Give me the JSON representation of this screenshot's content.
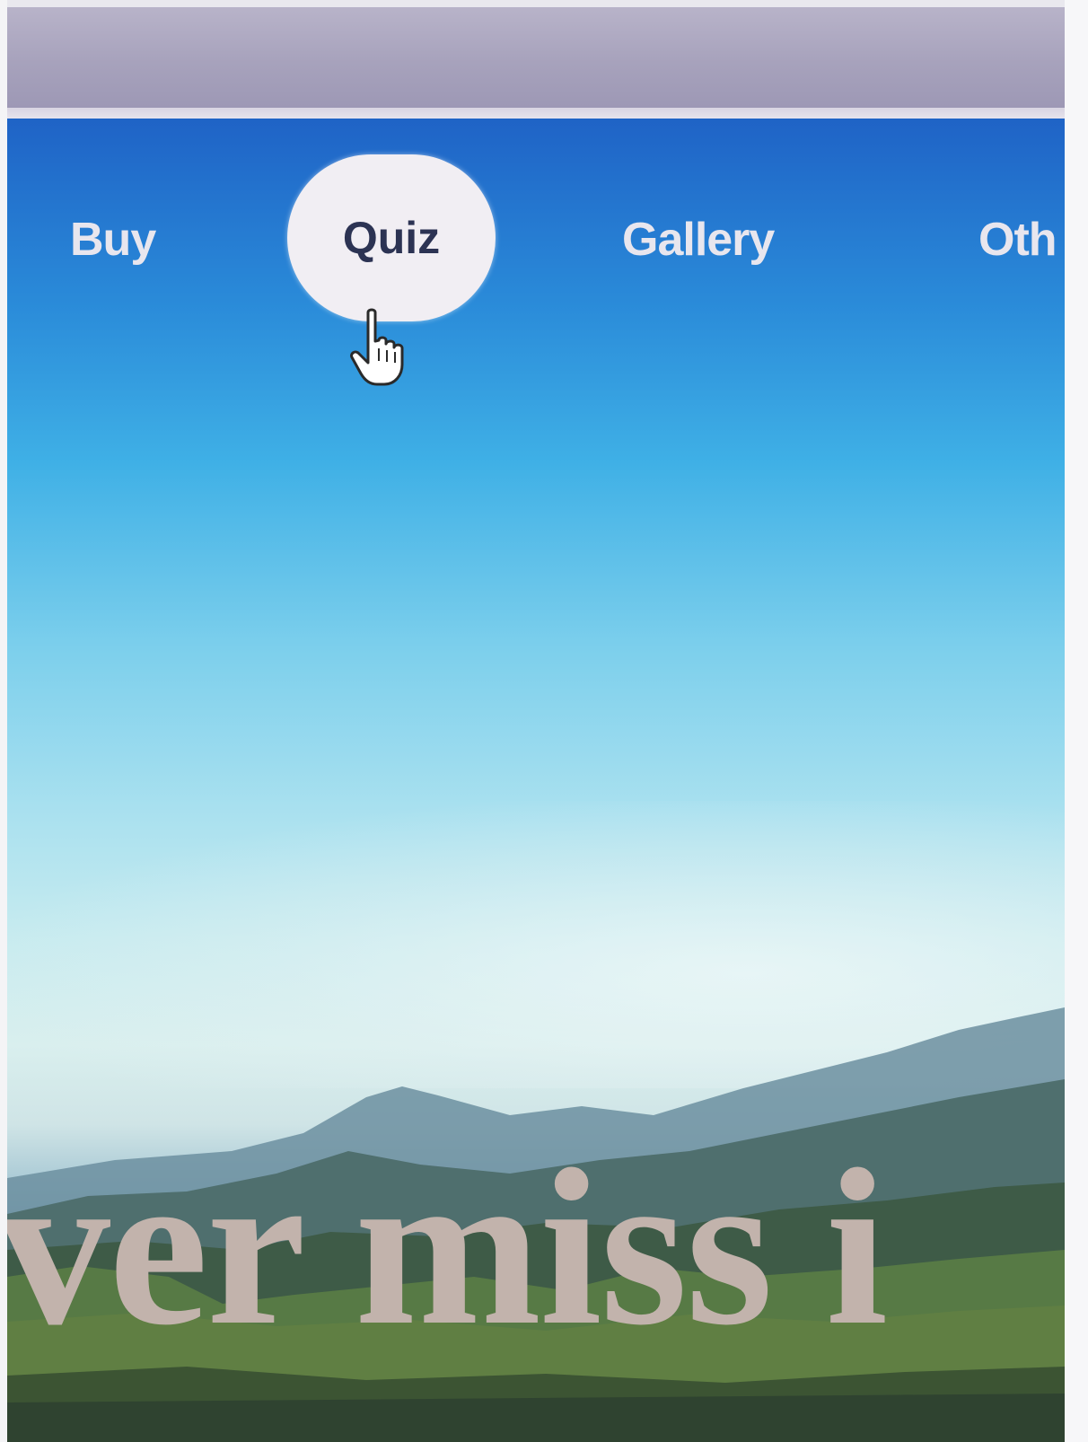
{
  "nav": {
    "items": [
      {
        "label": "Buy"
      },
      {
        "label": "Quiz",
        "active": true
      },
      {
        "label": "Gallery"
      },
      {
        "label": "Oth"
      }
    ]
  },
  "hero": {
    "headline": "ver miss i"
  },
  "colors": {
    "sky_top": "#1f63c6",
    "sky_mid": "#7ccfec",
    "nav_text": "#e8e6ee",
    "active_pill": "#f1eef3",
    "active_text": "#2c3353",
    "headline": "#c2b3ac"
  },
  "icons": {
    "cursor": "hand-pointer-icon"
  }
}
